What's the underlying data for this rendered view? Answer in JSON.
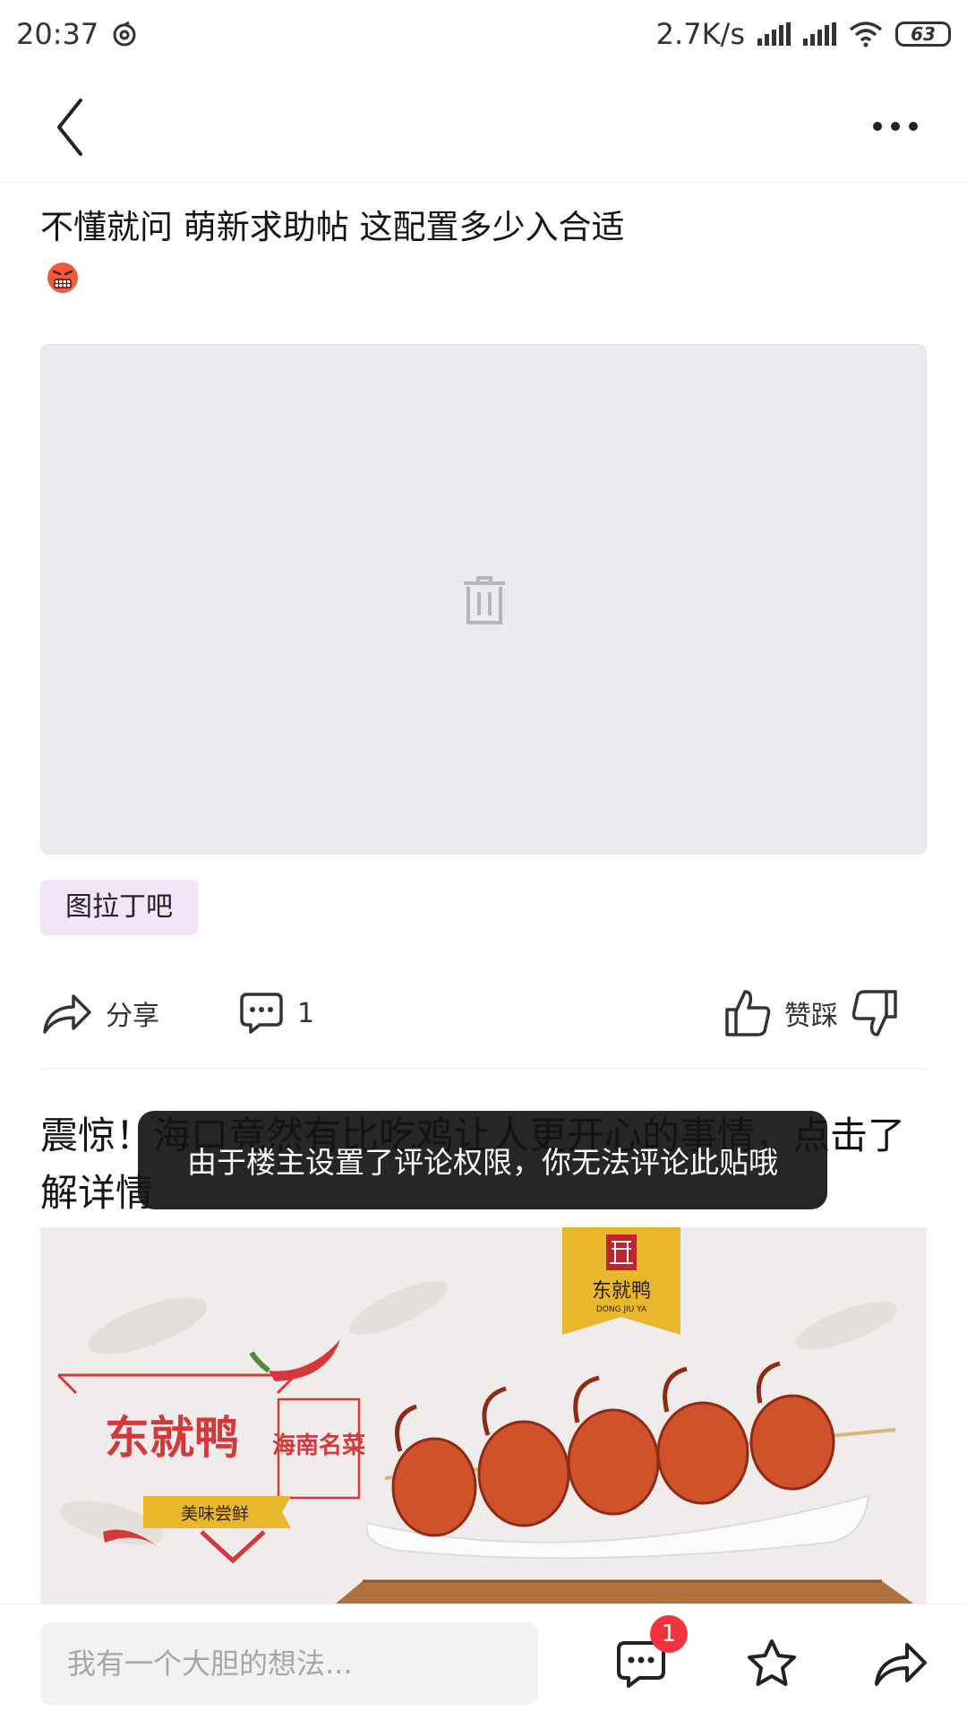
{
  "status_bar": {
    "time": "20:37",
    "network_speed": "2.7K/s",
    "battery": "63",
    "icons": [
      "netease-cloud-music-icon",
      "signal-icon",
      "signal-icon",
      "wifi-icon",
      "battery-icon"
    ]
  },
  "nav": {
    "icons": [
      "back-arrow-icon",
      "more-dots-icon"
    ]
  },
  "post": {
    "title": "不懂就问 萌新求助帖 这配置多少入合适",
    "emoji": "angry-face-icon",
    "image_placeholder_icon": "trash-icon",
    "forum_tag": "图拉丁吧",
    "actions": {
      "share_label": "分享",
      "comment_count": "1",
      "vote_label": "赞踩"
    }
  },
  "ad": {
    "title": "震惊！海口竟然有比吃鸡让人更开心的事情，点击了解详情",
    "brand_name": "东就鸭",
    "brand_pinyin": "DONG JIU YA",
    "slogan_badge": "海南名菜",
    "tagline": "美味尝鲜"
  },
  "toast": {
    "message": "由于楼主设置了评论权限，你无法评论此贴哦"
  },
  "bottom_bar": {
    "comment_placeholder": "我有一个大胆的想法...",
    "comment_badge": "1",
    "icons": [
      "comment-icon",
      "star-icon",
      "share-icon"
    ]
  },
  "colors": {
    "tag_background": "#f3e5f7",
    "badge_red": "#f0343d",
    "ad_yellow": "#e9b72c",
    "ad_red": "#d5383b"
  }
}
